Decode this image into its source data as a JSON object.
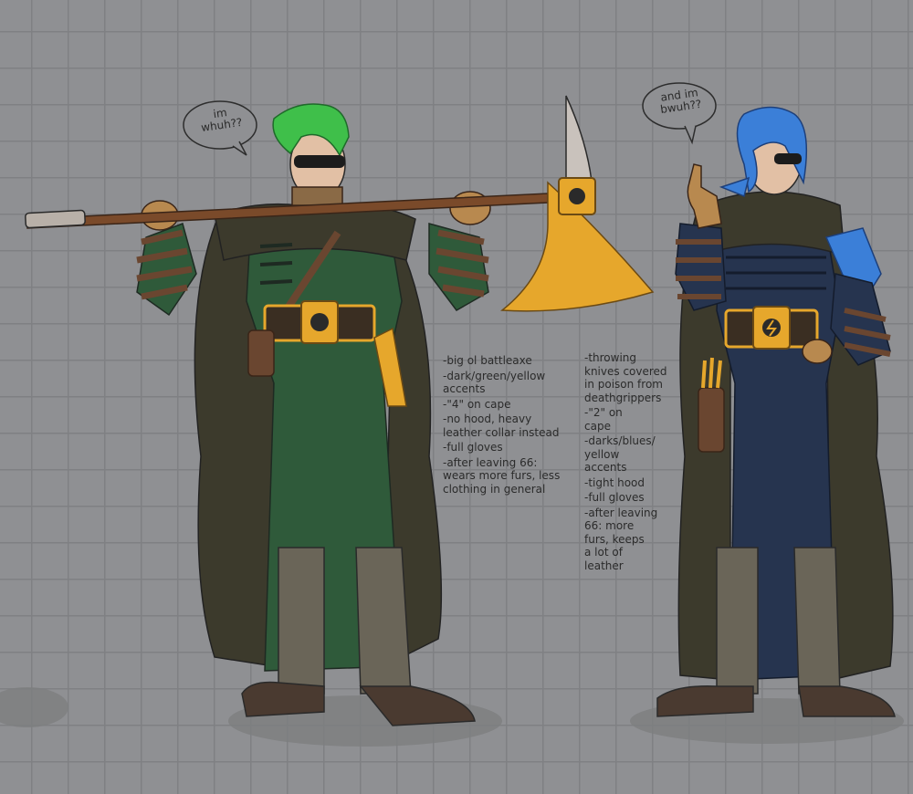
{
  "speech": {
    "green": "im\nwhuh??",
    "blue": "and im\nbwuh??"
  },
  "notes": {
    "green": [
      [
        "-big ol battleaxe"
      ],
      [
        "-dark/green/yellow",
        "accents"
      ],
      [
        "-\"4\" on cape"
      ],
      [
        "-no hood, heavy",
        "leather collar instead"
      ],
      [
        "-full gloves"
      ],
      [
        "-after leaving 66:",
        "wears more furs, less",
        "clothing in general"
      ]
    ],
    "blue": [
      [
        "-throwing",
        "knives covered",
        "in poison from",
        "deathgrippers"
      ],
      [
        "-\"2\" on",
        "cape"
      ],
      [
        "-darks/blues/",
        "yellow",
        "accents"
      ],
      [
        "-tight hood"
      ],
      [
        "-full gloves"
      ],
      [
        "-after leaving",
        "66: more",
        "furs, keeps",
        "a lot of",
        "leather"
      ]
    ]
  },
  "colors": {
    "background": "#8f9093",
    "grid": "#7f8083",
    "cape": "#3c3a2c",
    "green_tunic": "#2f5a3a",
    "blue_tunic": "#26344f",
    "gold": "#e6a72c",
    "leather": "#6a4630",
    "green_hair": "#3fbf4a",
    "blue_hair": "#3b7fd8",
    "boots": "#6a6558"
  }
}
